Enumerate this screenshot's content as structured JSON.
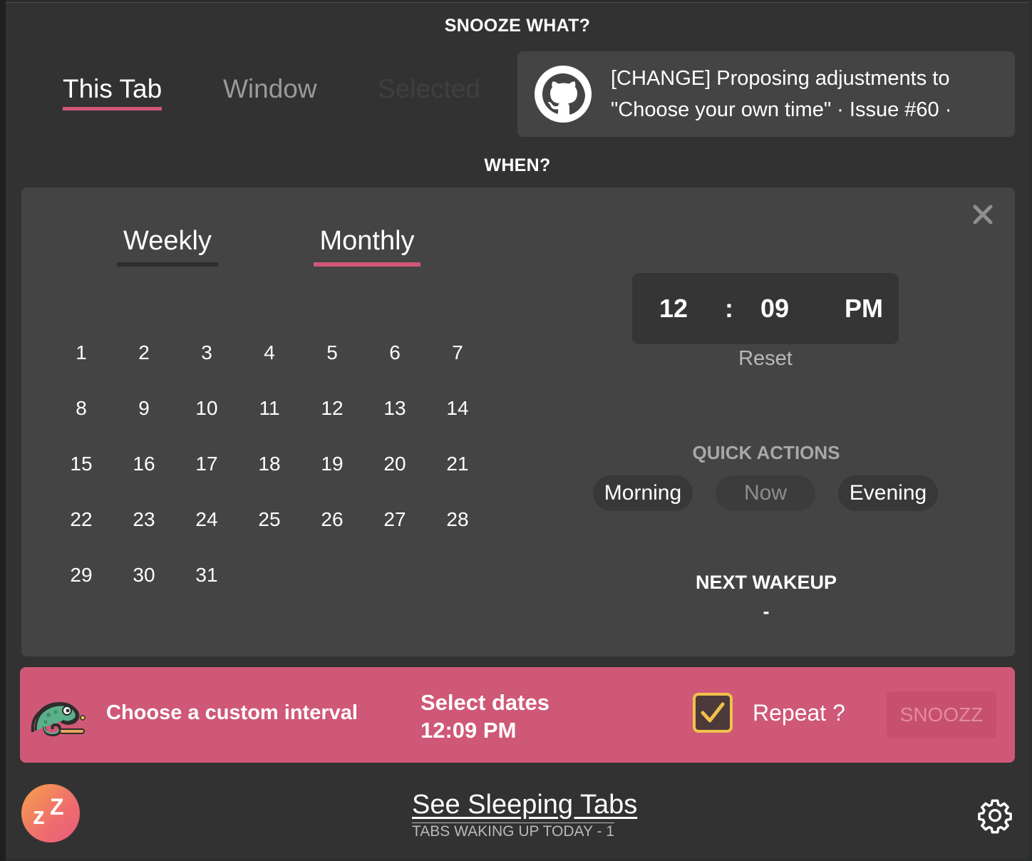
{
  "snooze_what": {
    "title": "SNOOZE WHAT?",
    "tabs": [
      {
        "label": "This Tab",
        "state": "active"
      },
      {
        "label": "Window",
        "state": "inactive"
      },
      {
        "label": "Selected",
        "state": "disabled"
      }
    ],
    "tab_info": {
      "icon": "github-icon",
      "title": "[CHANGE] Proposing adjustments to \"Choose your own time\" · Issue #60 ·"
    }
  },
  "when": {
    "title": "WHEN?",
    "modes": [
      {
        "label": "Weekly",
        "state": "inactive"
      },
      {
        "label": "Monthly",
        "state": "active"
      }
    ],
    "days": [
      "1",
      "2",
      "3",
      "4",
      "5",
      "6",
      "7",
      "8",
      "9",
      "10",
      "11",
      "12",
      "13",
      "14",
      "15",
      "16",
      "17",
      "18",
      "19",
      "20",
      "21",
      "22",
      "23",
      "24",
      "25",
      "26",
      "27",
      "28",
      "29",
      "30",
      "31"
    ],
    "time": {
      "hour": "12",
      "separator": ":",
      "minute": "09",
      "period": "PM"
    },
    "reset_label": "Reset",
    "quick_actions": {
      "title": "QUICK ACTIONS",
      "buttons": [
        "Morning",
        "Now",
        "Evening"
      ]
    },
    "next_wakeup": {
      "title": "NEXT WAKEUP",
      "value": "-"
    }
  },
  "action_bar": {
    "icon": "chameleon-icon",
    "interval_text": "Choose a custom interval",
    "select_dates": "Select dates",
    "selected_time": "12:09 PM",
    "repeat_label": "Repeat ?",
    "repeat_checked": true,
    "snooze_button": "SNOOZZ"
  },
  "footer": {
    "logo_text": "zZ",
    "see_sleeping": "See Sleeping Tabs",
    "waking_today": "TABS WAKING UP TODAY - 1"
  },
  "colors": {
    "accent": "#cf5877",
    "panel": "#444444",
    "background": "#323232",
    "checkbox_border": "#f0c14b"
  }
}
